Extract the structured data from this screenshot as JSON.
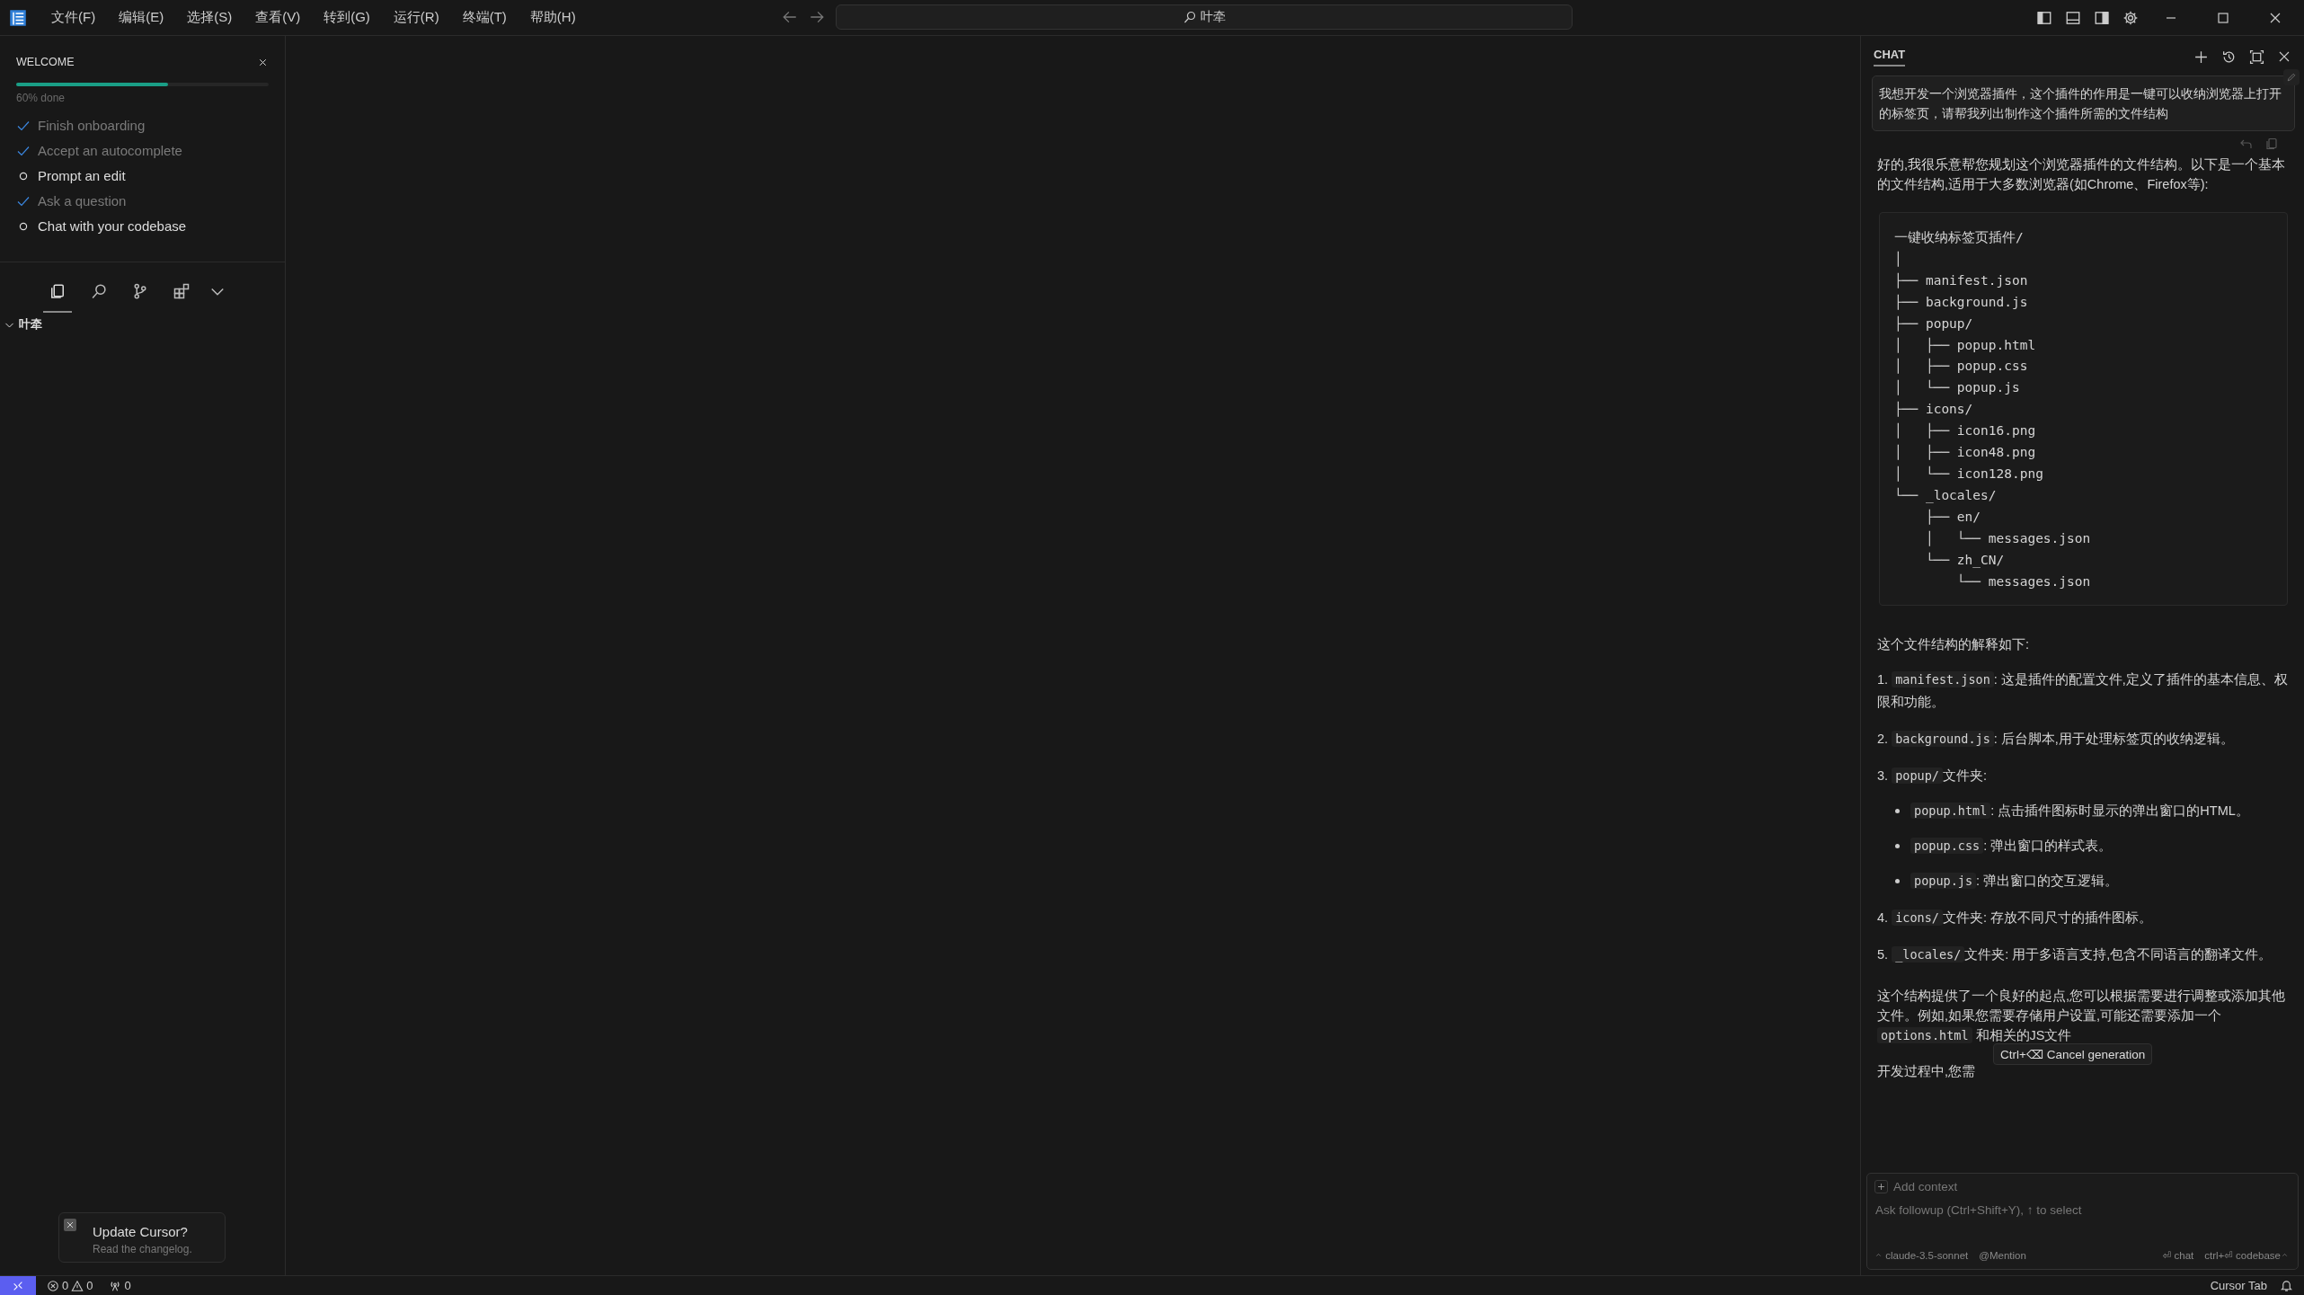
{
  "menu": [
    "文件(F)",
    "编辑(E)",
    "选择(S)",
    "查看(V)",
    "转到(G)",
    "运行(R)",
    "终端(T)",
    "帮助(H)"
  ],
  "command_center": {
    "label": "叶牵"
  },
  "welcome": {
    "title": "WELCOME",
    "progress": {
      "level": 0.6,
      "label": "60% done"
    },
    "steps": [
      {
        "label": "Finish onboarding",
        "checked": true
      },
      {
        "label": "Accept an autocomplete",
        "checked": true
      },
      {
        "label": "Prompt an edit",
        "checked": false
      },
      {
        "label": "Ask a question",
        "checked": true
      },
      {
        "label": "Chat with your codebase",
        "checked": false
      }
    ]
  },
  "views": [
    {
      "kind": "files",
      "selected": true
    },
    {
      "kind": "search",
      "selected": false
    },
    {
      "kind": "source-control",
      "selected": false
    },
    {
      "kind": "extensions",
      "selected": false
    }
  ],
  "folder": {
    "name": "叶牵",
    "expanded": true
  },
  "toast": {
    "title": "Update Cursor?",
    "message": "Read the changelog."
  },
  "chat": {
    "title": "CHAT",
    "user_message": "我想开发一个浏览器插件，这个插件的作用是一键可以收纳浏览器上打开的标签页，请帮我列出制作这个插件所需的文件结构",
    "intro": "好的,我很乐意帮您规划这个浏览器插件的文件结构。以下是一个基本的文件结构,适用于大多数浏览器(如Chrome、Firefox等):",
    "code_lines": [
      "一键收纳标签页插件/",
      "│",
      "├── manifest.json",
      "├── background.js",
      "├── popup/",
      "│   ├── popup.html",
      "│   ├── popup.css",
      "│   └── popup.js",
      "├── icons/",
      "│   ├── icon16.png",
      "│   ├── icon48.png",
      "│   └── icon128.png",
      "└── _locales/",
      "    ├── en/",
      "    │   └── messages.json",
      "    └── zh_CN/",
      "        └── messages.json"
    ],
    "explanation_heading": "这个文件结构的解释如下:",
    "items": [
      {
        "number": "1.",
        "code": "manifest.json",
        "text": ": 这是插件的配置文件,定义了插件的基本信息、权限和功能。"
      },
      {
        "number": "2.",
        "code": "background.js",
        "text": ": 后台脚本,用于处理标签页的收纳逻辑。"
      },
      {
        "number": "3.",
        "code": "popup/",
        "text": "文件夹:",
        "children": [
          {
            "code": "popup.html",
            "text": ": 点击插件图标时显示的弹出窗口的HTML。"
          },
          {
            "code": "popup.css",
            "text": ": 弹出窗口的样式表。"
          },
          {
            "code": "popup.js",
            "text": ": 弹出窗口的交互逻辑。"
          }
        ]
      },
      {
        "number": "4.",
        "code": "icons/",
        "text": "文件夹: 存放不同尺寸的插件图标。"
      },
      {
        "number": "5.",
        "code": "_locales/",
        "text": "文件夹: 用于多语言支持,包含不同语言的翻译文件。"
      }
    ],
    "closing": {
      "before": "这个结构提供了一个良好的起点,您可以根据需要进行调整或添加其他文件。例如,如果您需要存储用户设置,可能还需要添加一个",
      "code": "options.html",
      "after": "和相关的JS文件"
    },
    "streaming": "开发过程中,您需",
    "tooltip": "Ctrl+⌫ Cancel generation",
    "input": {
      "add_context": "Add context",
      "placeholder": "Ask followup (Ctrl+Shift+Y), ↑ to select",
      "model": "claude-3.5-sonnet",
      "mention": "@Mention",
      "send_chat": "⏎ chat",
      "send_codebase": "ctrl+⏎ codebase"
    }
  },
  "status_bar": {
    "errors": "0",
    "warnings": "0",
    "ports": "0",
    "cursor_tab": "Cursor Tab"
  }
}
